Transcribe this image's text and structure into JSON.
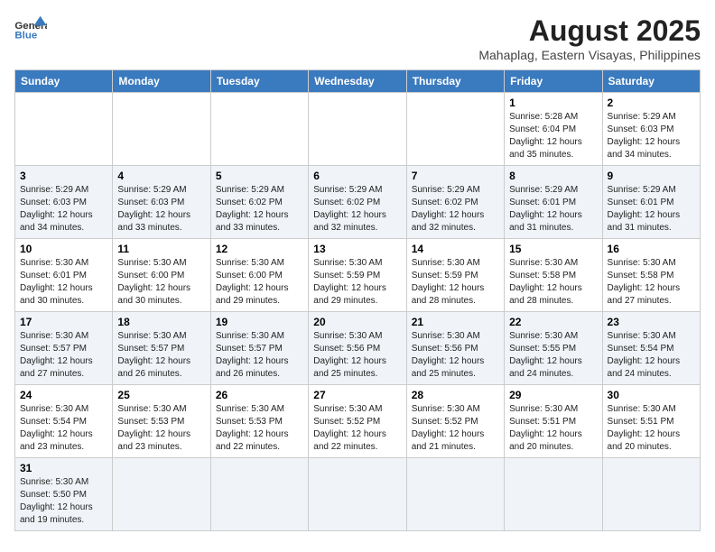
{
  "header": {
    "logo_text_normal": "General",
    "logo_text_bold": "Blue",
    "title": "August 2025",
    "subtitle": "Mahaplag, Eastern Visayas, Philippines"
  },
  "weekdays": [
    "Sunday",
    "Monday",
    "Tuesday",
    "Wednesday",
    "Thursday",
    "Friday",
    "Saturday"
  ],
  "weeks": [
    [
      {
        "day": "",
        "info": ""
      },
      {
        "day": "",
        "info": ""
      },
      {
        "day": "",
        "info": ""
      },
      {
        "day": "",
        "info": ""
      },
      {
        "day": "",
        "info": ""
      },
      {
        "day": "1",
        "info": "Sunrise: 5:28 AM\nSunset: 6:04 PM\nDaylight: 12 hours and 35 minutes."
      },
      {
        "day": "2",
        "info": "Sunrise: 5:29 AM\nSunset: 6:03 PM\nDaylight: 12 hours and 34 minutes."
      }
    ],
    [
      {
        "day": "3",
        "info": "Sunrise: 5:29 AM\nSunset: 6:03 PM\nDaylight: 12 hours and 34 minutes."
      },
      {
        "day": "4",
        "info": "Sunrise: 5:29 AM\nSunset: 6:03 PM\nDaylight: 12 hours and 33 minutes."
      },
      {
        "day": "5",
        "info": "Sunrise: 5:29 AM\nSunset: 6:02 PM\nDaylight: 12 hours and 33 minutes."
      },
      {
        "day": "6",
        "info": "Sunrise: 5:29 AM\nSunset: 6:02 PM\nDaylight: 12 hours and 32 minutes."
      },
      {
        "day": "7",
        "info": "Sunrise: 5:29 AM\nSunset: 6:02 PM\nDaylight: 12 hours and 32 minutes."
      },
      {
        "day": "8",
        "info": "Sunrise: 5:29 AM\nSunset: 6:01 PM\nDaylight: 12 hours and 31 minutes."
      },
      {
        "day": "9",
        "info": "Sunrise: 5:29 AM\nSunset: 6:01 PM\nDaylight: 12 hours and 31 minutes."
      }
    ],
    [
      {
        "day": "10",
        "info": "Sunrise: 5:30 AM\nSunset: 6:01 PM\nDaylight: 12 hours and 30 minutes."
      },
      {
        "day": "11",
        "info": "Sunrise: 5:30 AM\nSunset: 6:00 PM\nDaylight: 12 hours and 30 minutes."
      },
      {
        "day": "12",
        "info": "Sunrise: 5:30 AM\nSunset: 6:00 PM\nDaylight: 12 hours and 29 minutes."
      },
      {
        "day": "13",
        "info": "Sunrise: 5:30 AM\nSunset: 5:59 PM\nDaylight: 12 hours and 29 minutes."
      },
      {
        "day": "14",
        "info": "Sunrise: 5:30 AM\nSunset: 5:59 PM\nDaylight: 12 hours and 28 minutes."
      },
      {
        "day": "15",
        "info": "Sunrise: 5:30 AM\nSunset: 5:58 PM\nDaylight: 12 hours and 28 minutes."
      },
      {
        "day": "16",
        "info": "Sunrise: 5:30 AM\nSunset: 5:58 PM\nDaylight: 12 hours and 27 minutes."
      }
    ],
    [
      {
        "day": "17",
        "info": "Sunrise: 5:30 AM\nSunset: 5:57 PM\nDaylight: 12 hours and 27 minutes."
      },
      {
        "day": "18",
        "info": "Sunrise: 5:30 AM\nSunset: 5:57 PM\nDaylight: 12 hours and 26 minutes."
      },
      {
        "day": "19",
        "info": "Sunrise: 5:30 AM\nSunset: 5:57 PM\nDaylight: 12 hours and 26 minutes."
      },
      {
        "day": "20",
        "info": "Sunrise: 5:30 AM\nSunset: 5:56 PM\nDaylight: 12 hours and 25 minutes."
      },
      {
        "day": "21",
        "info": "Sunrise: 5:30 AM\nSunset: 5:56 PM\nDaylight: 12 hours and 25 minutes."
      },
      {
        "day": "22",
        "info": "Sunrise: 5:30 AM\nSunset: 5:55 PM\nDaylight: 12 hours and 24 minutes."
      },
      {
        "day": "23",
        "info": "Sunrise: 5:30 AM\nSunset: 5:54 PM\nDaylight: 12 hours and 24 minutes."
      }
    ],
    [
      {
        "day": "24",
        "info": "Sunrise: 5:30 AM\nSunset: 5:54 PM\nDaylight: 12 hours and 23 minutes."
      },
      {
        "day": "25",
        "info": "Sunrise: 5:30 AM\nSunset: 5:53 PM\nDaylight: 12 hours and 23 minutes."
      },
      {
        "day": "26",
        "info": "Sunrise: 5:30 AM\nSunset: 5:53 PM\nDaylight: 12 hours and 22 minutes."
      },
      {
        "day": "27",
        "info": "Sunrise: 5:30 AM\nSunset: 5:52 PM\nDaylight: 12 hours and 22 minutes."
      },
      {
        "day": "28",
        "info": "Sunrise: 5:30 AM\nSunset: 5:52 PM\nDaylight: 12 hours and 21 minutes."
      },
      {
        "day": "29",
        "info": "Sunrise: 5:30 AM\nSunset: 5:51 PM\nDaylight: 12 hours and 20 minutes."
      },
      {
        "day": "30",
        "info": "Sunrise: 5:30 AM\nSunset: 5:51 PM\nDaylight: 12 hours and 20 minutes."
      }
    ],
    [
      {
        "day": "31",
        "info": "Sunrise: 5:30 AM\nSunset: 5:50 PM\nDaylight: 12 hours and 19 minutes."
      },
      {
        "day": "",
        "info": ""
      },
      {
        "day": "",
        "info": ""
      },
      {
        "day": "",
        "info": ""
      },
      {
        "day": "",
        "info": ""
      },
      {
        "day": "",
        "info": ""
      },
      {
        "day": "",
        "info": ""
      }
    ]
  ]
}
